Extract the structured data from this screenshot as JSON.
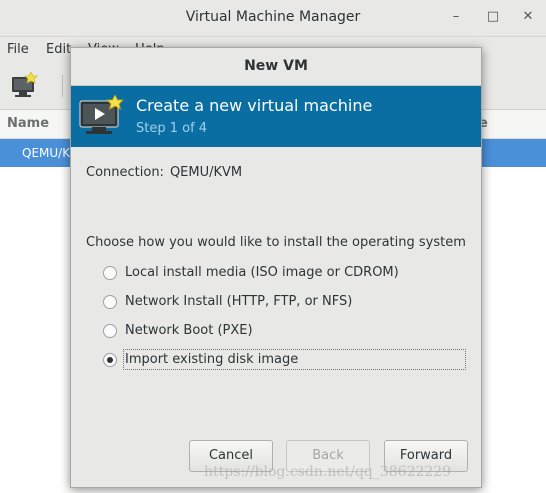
{
  "main_window": {
    "title": "Virtual Machine Manager",
    "menu": [
      "File",
      "Edit",
      "View",
      "Help"
    ],
    "list_header": {
      "name": "Name",
      "right_partial": "e"
    },
    "selected_row": "QEMU/KVM"
  },
  "dialog": {
    "title": "New VM",
    "banner": {
      "title": "Create a new virtual machine",
      "step": "Step 1 of 4"
    },
    "connection": {
      "label": "Connection:",
      "value": "QEMU/KVM"
    },
    "prompt": "Choose how you would like to install the operating system",
    "options": [
      {
        "label": "Local install media (ISO image or CDROM)",
        "selected": false
      },
      {
        "label": "Network Install (HTTP, FTP, or NFS)",
        "selected": false
      },
      {
        "label": "Network Boot (PXE)",
        "selected": false
      },
      {
        "label": "Import existing disk image",
        "selected": true
      }
    ],
    "buttons": {
      "cancel": "Cancel",
      "back": "Back",
      "forward": "Forward"
    }
  },
  "watermark": "https://blog.csdn.net/qq_38622229",
  "colors": {
    "banner": "#0a6ea2",
    "selection": "#4a90d9"
  }
}
